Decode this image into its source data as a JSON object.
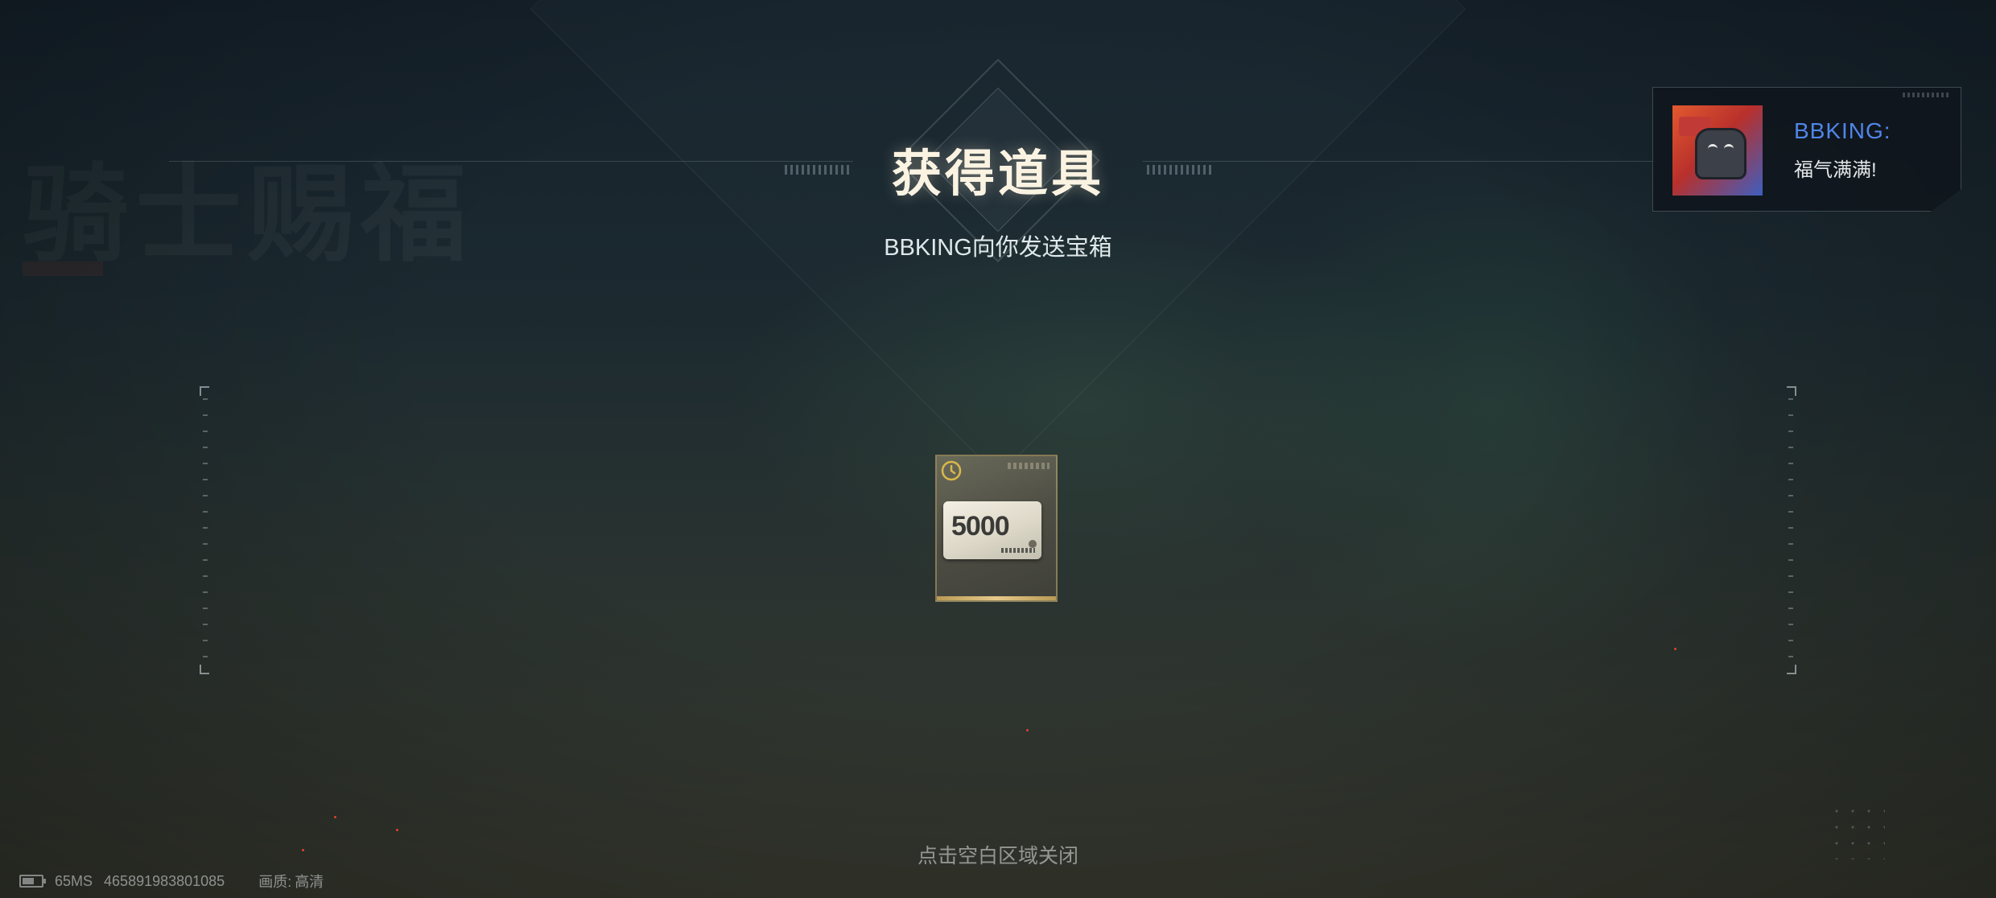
{
  "reward_popup": {
    "title": "获得道具",
    "subtitle": "BBKING向你发送宝箱",
    "close_hint": "点击空白区域关闭"
  },
  "item": {
    "icon": "clock-icon",
    "value": "5000",
    "accent_color": "#d9b84a"
  },
  "chat_toast": {
    "sender": "BBKING:",
    "message": "福气满满!",
    "name_color": "#4f86e8"
  },
  "status_bar": {
    "icon": "battery-icon",
    "latency": "65MS",
    "player_id": "465891983801085",
    "quality_label": "画质:",
    "quality_value": "高清"
  }
}
